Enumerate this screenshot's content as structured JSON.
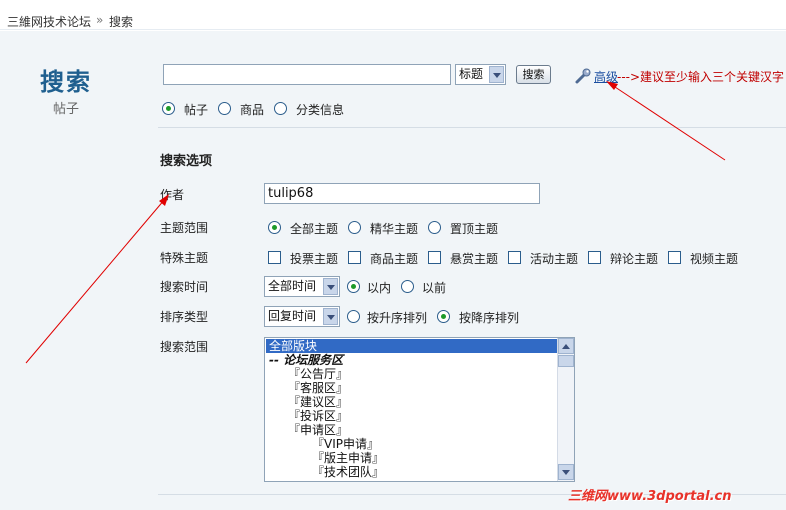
{
  "breadcrumb": {
    "home": "三維网技术论坛",
    "separator": "»",
    "current": "搜索"
  },
  "page": {
    "title": "搜索",
    "subtitle": "帖子"
  },
  "search": {
    "keyword_value": "",
    "type_selected": "标题",
    "submit_label": "搜索",
    "advanced_link": "高级",
    "annotation": "--->建议至少输入三个关键汉字",
    "categories": [
      {
        "label": "帖子",
        "checked": true
      },
      {
        "label": "商品",
        "checked": false
      },
      {
        "label": "分类信息",
        "checked": false
      }
    ]
  },
  "options": {
    "title": "搜索选项",
    "author": {
      "label": "作者",
      "value": "tulip68"
    },
    "topic_range": {
      "label": "主题范围",
      "items": [
        {
          "label": "全部主题",
          "checked": true
        },
        {
          "label": "精华主题",
          "checked": false
        },
        {
          "label": "置顶主题",
          "checked": false
        }
      ]
    },
    "special": {
      "label": "特殊主题",
      "items": [
        {
          "label": "投票主题",
          "checked": false
        },
        {
          "label": "商品主题",
          "checked": false
        },
        {
          "label": "悬赏主题",
          "checked": false
        },
        {
          "label": "活动主题",
          "checked": false
        },
        {
          "label": "辩论主题",
          "checked": false
        },
        {
          "label": "视频主题",
          "checked": false
        }
      ]
    },
    "time": {
      "label": "搜索时间",
      "selected": "全部时间",
      "items": [
        {
          "label": "以内",
          "checked": true
        },
        {
          "label": "以前",
          "checked": false
        }
      ]
    },
    "sort": {
      "label": "排序类型",
      "selected": "回复时间",
      "items": [
        {
          "label": "按升序排列",
          "checked": false
        },
        {
          "label": "按降序排列",
          "checked": true
        }
      ]
    },
    "forums": {
      "label": "搜索范围",
      "items": [
        {
          "label": "全部版块",
          "selected": true
        },
        {
          "label": "-- 论坛服务区",
          "selected": false
        },
        {
          "label": "『公告厅』",
          "selected": false
        },
        {
          "label": "『客服区』",
          "selected": false
        },
        {
          "label": "『建议区』",
          "selected": false
        },
        {
          "label": "『投诉区』",
          "selected": false
        },
        {
          "label": "『申请区』",
          "selected": false
        },
        {
          "label": "『VIP申请』",
          "selected": false
        },
        {
          "label": "『版主申请』",
          "selected": false
        },
        {
          "label": "『技术团队』",
          "selected": false
        }
      ]
    }
  },
  "watermark": "三维网www.3dportal.cn",
  "colors": {
    "title_blue": "#1f5f8f",
    "panel_bg": "#f1f5f8",
    "annotation_red": "#c00000",
    "arrow_red": "#e00000",
    "selection_blue": "#316ac5"
  },
  "icons": {
    "advanced": "wrench-icon"
  }
}
